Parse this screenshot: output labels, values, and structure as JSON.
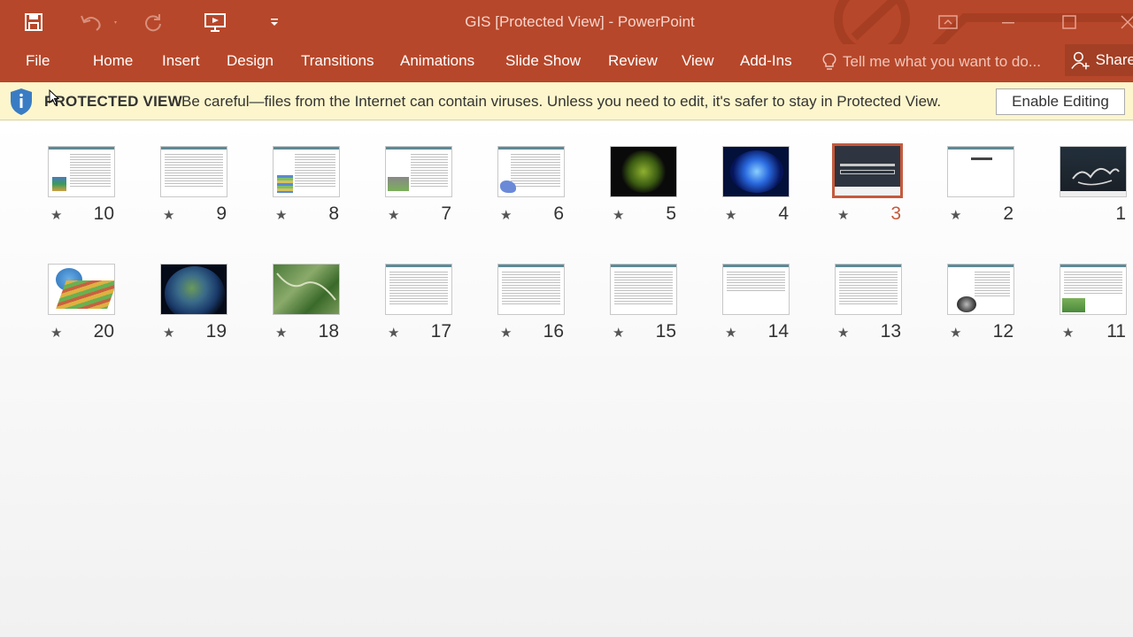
{
  "window": {
    "title": "GIS [Protected View] - PowerPoint"
  },
  "quick_access": [
    {
      "name": "save-icon"
    },
    {
      "name": "undo-icon"
    },
    {
      "name": "redo-icon"
    },
    {
      "name": "start-from-beginning-icon"
    },
    {
      "name": "customize-qat-icon"
    }
  ],
  "ribbon": {
    "tabs": [
      "File",
      "Home",
      "Insert",
      "Design",
      "Transitions",
      "Animations",
      "Slide Show",
      "Review",
      "View",
      "Add-Ins"
    ],
    "tell_me": "Tell me what you want to do...",
    "share": "Share"
  },
  "protected_view": {
    "title": "PROTECTED VIEW",
    "message": "Be careful—files from the Internet can contain viruses. Unless you need to edit, it's safer to stay in Protected View.",
    "button": "Enable Editing"
  },
  "slides": {
    "row1": [
      "10",
      "9",
      "8",
      "7",
      "6",
      "5",
      "4",
      "3",
      "2",
      "1"
    ],
    "row2": [
      "20",
      "19",
      "18",
      "17",
      "16",
      "15",
      "14",
      "13",
      "12",
      "11"
    ],
    "selected": "3"
  },
  "colors": {
    "accent": "#b7472a",
    "selection": "#c55a3d",
    "banner": "#fdf6cc"
  }
}
